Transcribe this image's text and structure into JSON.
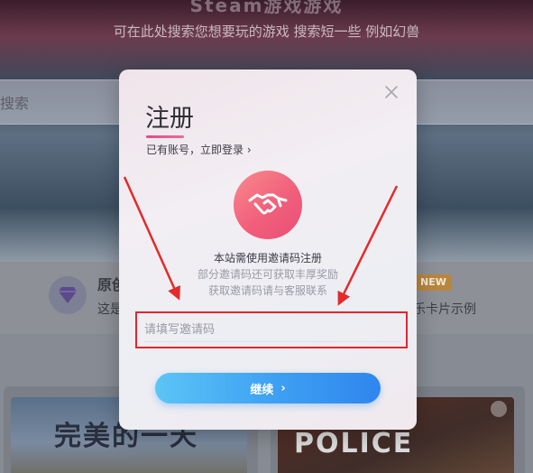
{
  "background": {
    "hero_title": "Steam游戏游戏",
    "hero_subtitle": "可在此处搜索您想要玩的游戏 搜索短一些 例如幻兽",
    "search_placeholder": "搜索",
    "feature_title": "原创",
    "feature_desc": "这是",
    "new_badge": "NEW",
    "right_desc": "乐卡片示例",
    "card_left_title": "完美的一天",
    "card_right_title": "POLICE"
  },
  "modal": {
    "title": "注册",
    "login_link": "已有账号，立即登录",
    "login_chevron": "›",
    "info_line1": "本站需使用邀请码注册",
    "info_line2": "部分邀请码还可获取丰厚奖励",
    "info_line3": "获取邀请码请与客服联系",
    "invite_placeholder": "请填写邀请码",
    "continue_label": "继续",
    "continue_chevron": "›"
  },
  "colors": {
    "accent_pink": "#e94e77",
    "button_blue": "#3d9ff3",
    "highlight_red": "#e0272f"
  }
}
